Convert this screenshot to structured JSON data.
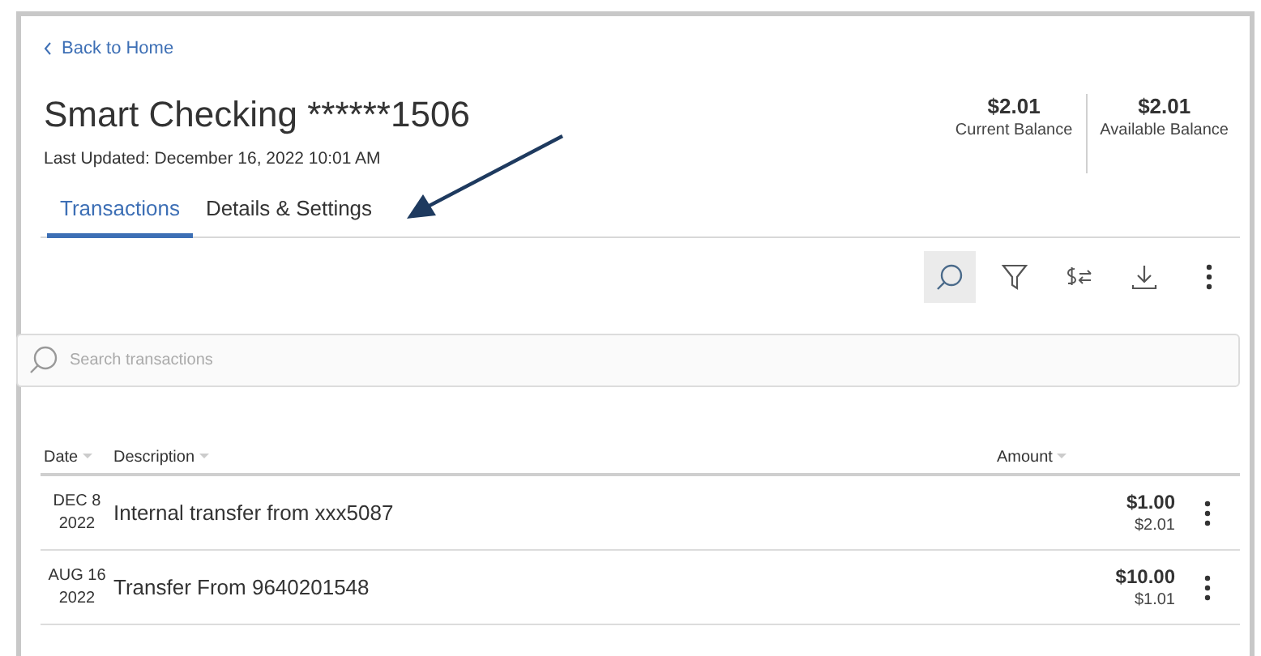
{
  "back_link": "Back to Home",
  "account": {
    "title": "Smart Checking ******1506",
    "last_updated": "Last Updated: December 16, 2022 10:01 AM"
  },
  "balances": [
    {
      "amount": "$2.01",
      "label": "Current Balance"
    },
    {
      "amount": "$2.01",
      "label": "Available Balance"
    }
  ],
  "tabs": [
    {
      "label": "Transactions",
      "selected": true
    },
    {
      "label": "Details & Settings",
      "selected": false
    }
  ],
  "toolbar": [
    {
      "kind": "search",
      "selected": true
    },
    {
      "kind": "filter",
      "selected": false
    },
    {
      "kind": "transfer",
      "selected": false
    },
    {
      "kind": "download",
      "selected": false
    },
    {
      "kind": "more",
      "selected": false
    }
  ],
  "search": {
    "placeholder": "Search transactions"
  },
  "table": {
    "columns": [
      "Date",
      "Description",
      "Amount"
    ],
    "rows": [
      {
        "month_day": "DEC 8",
        "year": "2022",
        "description": "Internal transfer from xxx5087",
        "amount": "$1.00",
        "balance": "$2.01"
      },
      {
        "month_day": "AUG 16",
        "year": "2022",
        "description": "Transfer From 9640201548",
        "amount": "$10.00",
        "balance": "$1.01"
      }
    ]
  }
}
